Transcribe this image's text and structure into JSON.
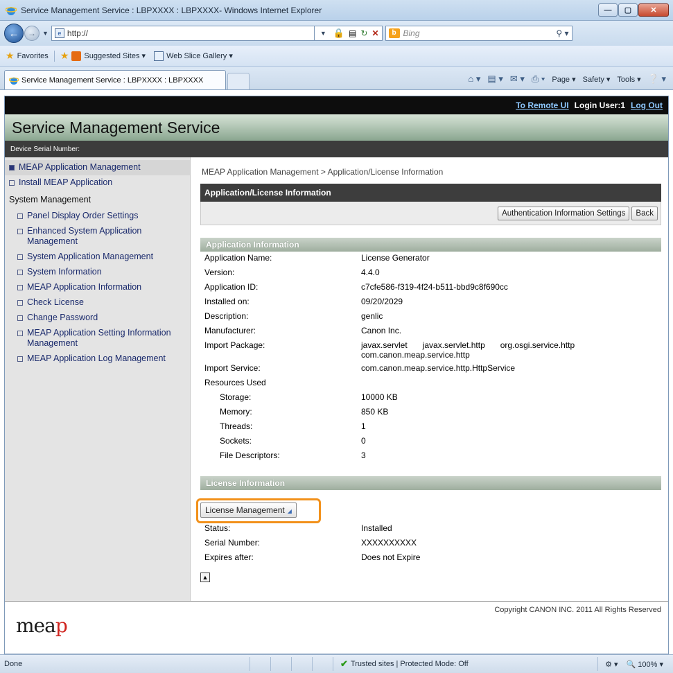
{
  "window": {
    "title": "Service Management Service : LBPXXXX : LBPXXXX- Windows Internet Explorer",
    "controls": [
      "—",
      "▢",
      "✕"
    ]
  },
  "addressbar": {
    "url": "http://",
    "search_placeholder": "Bing"
  },
  "favorites": {
    "label": "Favorites",
    "items": [
      "Suggested Sites ▾",
      "Web Slice Gallery ▾"
    ]
  },
  "tabs": {
    "active_label": "Service Management Service : LBPXXXX : LBPXXXX",
    "commands": [
      "Page ▾",
      "Safety ▾",
      "Tools ▾"
    ]
  },
  "topnav": {
    "remote_ui": "To Remote UI",
    "login_user": "Login User:1",
    "logout": "Log Out"
  },
  "banner": {
    "title": "Service Management Service"
  },
  "serial": {
    "label": "Device Serial Number:"
  },
  "sidebar": {
    "meap_mgmt": "MEAP Application Management",
    "install": "Install MEAP Application",
    "system_header": "System Management",
    "items": [
      "Panel Display Order Settings",
      "Enhanced System Application Management",
      "System Application Management",
      "System Information",
      "MEAP Application Information",
      "Check License",
      "Change Password",
      "MEAP Application Setting Information Management",
      "MEAP Application Log Management"
    ]
  },
  "main": {
    "breadcrumb": "MEAP Application Management > Application/License Information",
    "panel_title": "Application/License Information",
    "auth_button": "Authentication Information Settings",
    "back_button": "Back",
    "app_section": "Application Information",
    "app_info": {
      "name_label": "Application Name:",
      "name": "License Generator",
      "version_label": "Version:",
      "version": "4.4.0",
      "id_label": "Application ID:",
      "id": "c7cfe586-f319-4f24-b511-bbd9c8f690cc",
      "installed_label": "Installed on:",
      "installed": "09/20/2029",
      "description_label": "Description:",
      "description": "genlic",
      "manufacturer_label": "Manufacturer:",
      "manufacturer": "Canon Inc.",
      "import_package_label": "Import Package:",
      "import_packages": [
        "javax.servlet",
        "javax.servlet.http",
        "org.osgi.service.http",
        "com.canon.meap.service.http"
      ],
      "import_service_label": "Import Service:",
      "import_service": "com.canon.meap.service.http.HttpService",
      "resources_label": "Resources Used",
      "storage_label": "Storage:",
      "storage": "10000 KB",
      "memory_label": "Memory:",
      "memory": "850 KB",
      "threads_label": "Threads:",
      "threads": "1",
      "sockets_label": "Sockets:",
      "sockets": "0",
      "fd_label": "File Descriptors:",
      "fd": "3"
    },
    "license_section": "License Information",
    "license_button": "License Management",
    "license_info": {
      "status_label": "Status:",
      "status": "Installed",
      "serial_label": "Serial Number:",
      "serial": "XXXXXXXXXX",
      "expires_label": "Expires after:",
      "expires": "Does not Expire"
    }
  },
  "footer": {
    "logo": "mea",
    "logo_end": "p",
    "copyright": "Copyright CANON INC. 2011 All Rights Reserved"
  },
  "statusbar": {
    "left": "Done",
    "zone": "Trusted sites | Protected Mode: Off",
    "zoom": "100%"
  },
  "colors": {
    "highlight": "#f2911b",
    "link": "#8ec8ff",
    "sidebar_text": "#1a2a6c"
  }
}
